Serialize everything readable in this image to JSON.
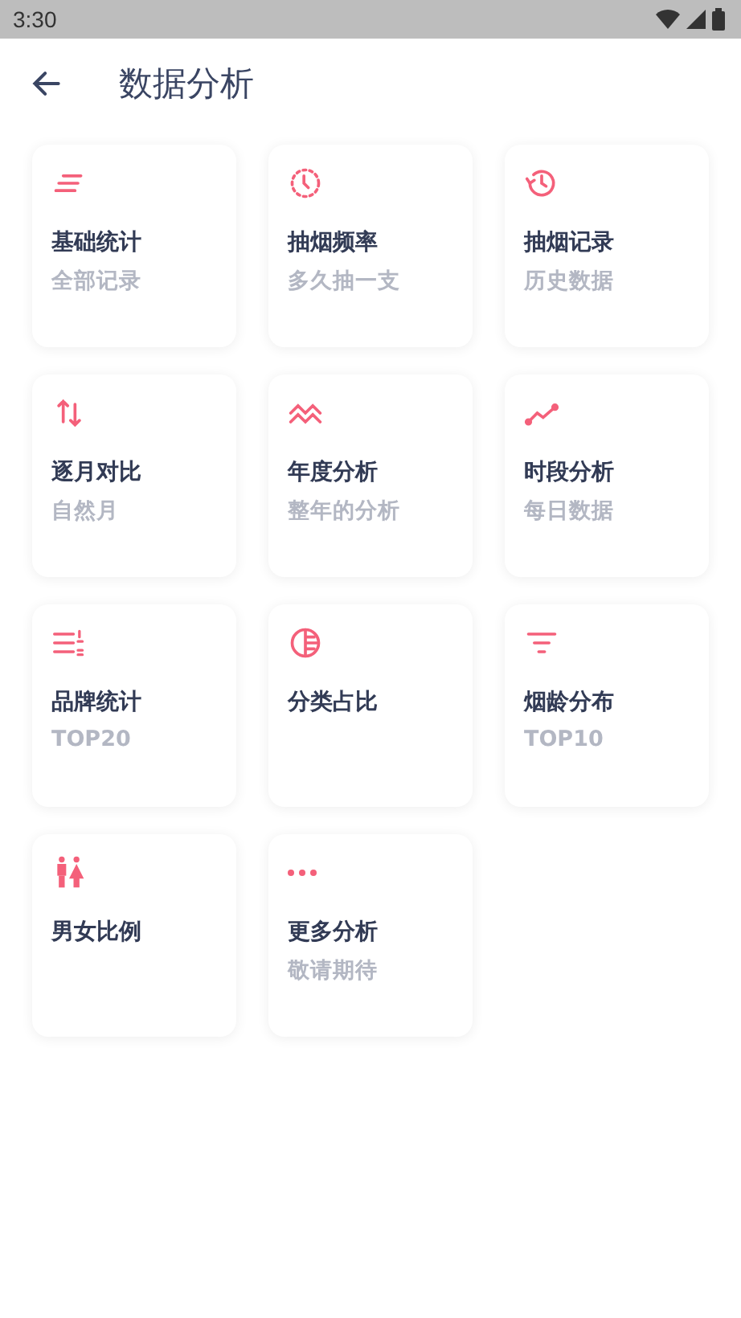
{
  "status_bar": {
    "time": "3:30"
  },
  "header": {
    "title": "数据分析"
  },
  "cards": [
    {
      "title": "基础统计",
      "subtitle": "全部记录"
    },
    {
      "title": "抽烟频率",
      "subtitle": "多久抽一支"
    },
    {
      "title": "抽烟记录",
      "subtitle": "历史数据"
    },
    {
      "title": "逐月对比",
      "subtitle": "自然月"
    },
    {
      "title": "年度分析",
      "subtitle": "整年的分析"
    },
    {
      "title": "时段分析",
      "subtitle": "每日数据"
    },
    {
      "title": "品牌统计",
      "subtitle": "TOP20"
    },
    {
      "title": "分类占比"
    },
    {
      "title": "烟龄分布",
      "subtitle": "TOP10"
    },
    {
      "title": "男女比例"
    },
    {
      "title": "更多分析",
      "subtitle": "敬请期待"
    }
  ]
}
